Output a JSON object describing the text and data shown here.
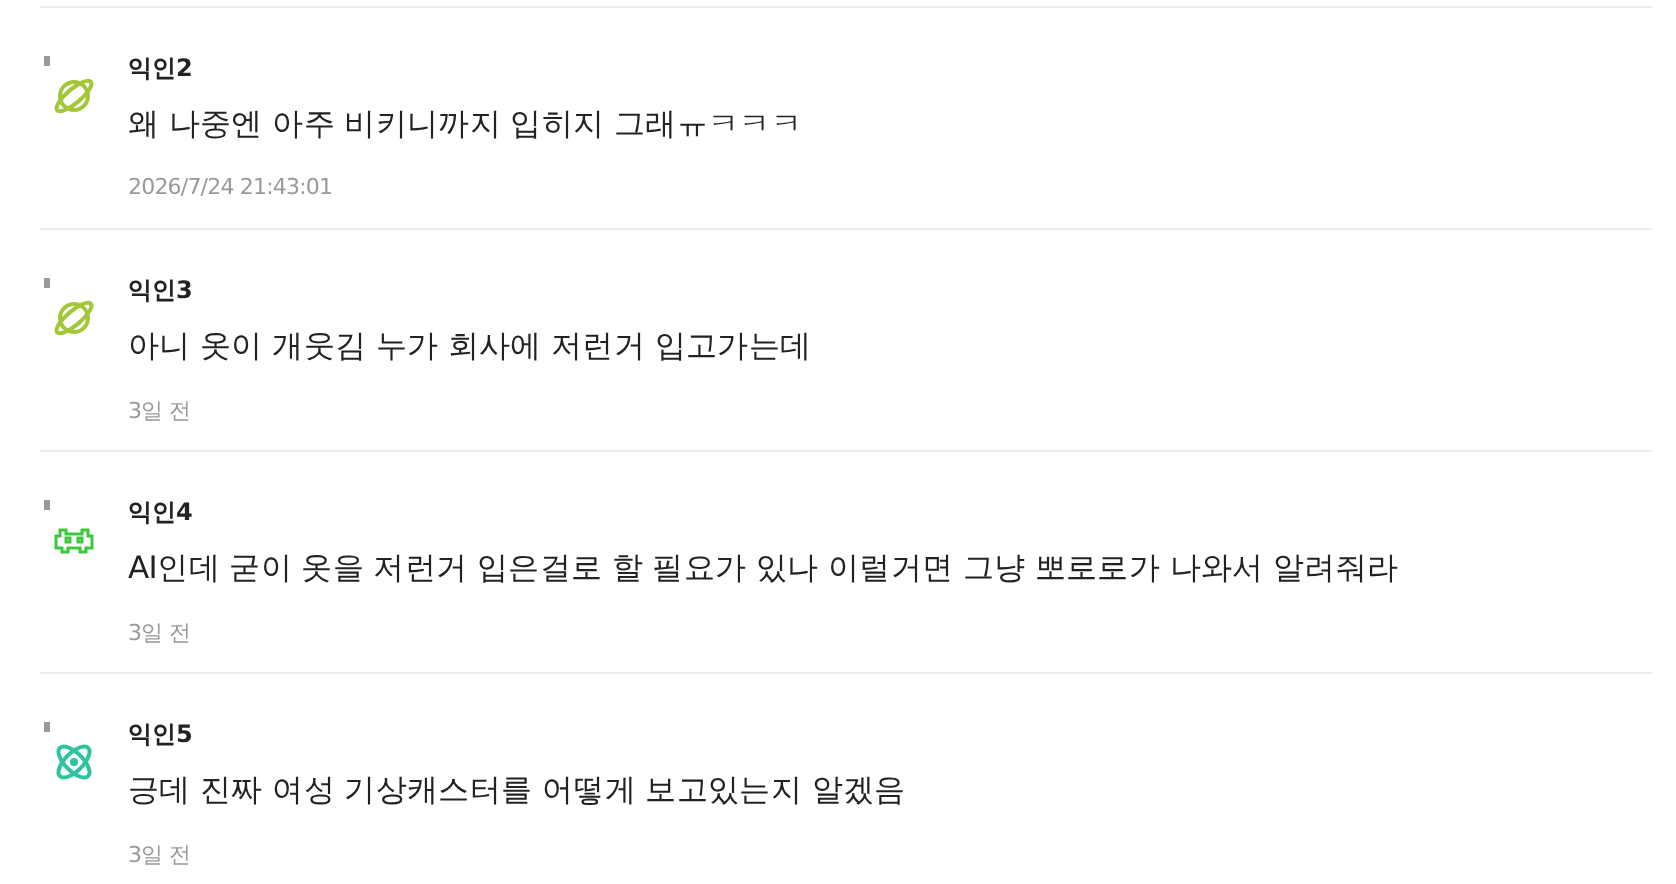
{
  "comments": [
    {
      "author": "익인2",
      "avatar": {
        "kind": "planet",
        "color": "#a4c639"
      },
      "text": "왜 나중엔 아주 비키니까지 입히지 그래ㅠㅋㅋㅋ",
      "time": "2026/7/24 21:43:01"
    },
    {
      "author": "익인3",
      "avatar": {
        "kind": "planet",
        "color": "#a4c639"
      },
      "text": "아니 옷이 개웃김 누가 회사에 저런거 입고가는데",
      "time": "3일 전"
    },
    {
      "author": "익인4",
      "avatar": {
        "kind": "invader",
        "color": "#3cc83c"
      },
      "text": "AI인데 굳이 옷을 저런거 입은걸로 할 필요가 있나 이럴거면 그냥 뽀로로가 나와서 알려줘라",
      "time": "3일 전"
    },
    {
      "author": "익인5",
      "avatar": {
        "kind": "atom",
        "color": "#2ec4a0"
      },
      "text": "긍데 진짜 여성 기상캐스터를 어떻게 보고있는지 알겠음",
      "time": "3일 전"
    }
  ]
}
